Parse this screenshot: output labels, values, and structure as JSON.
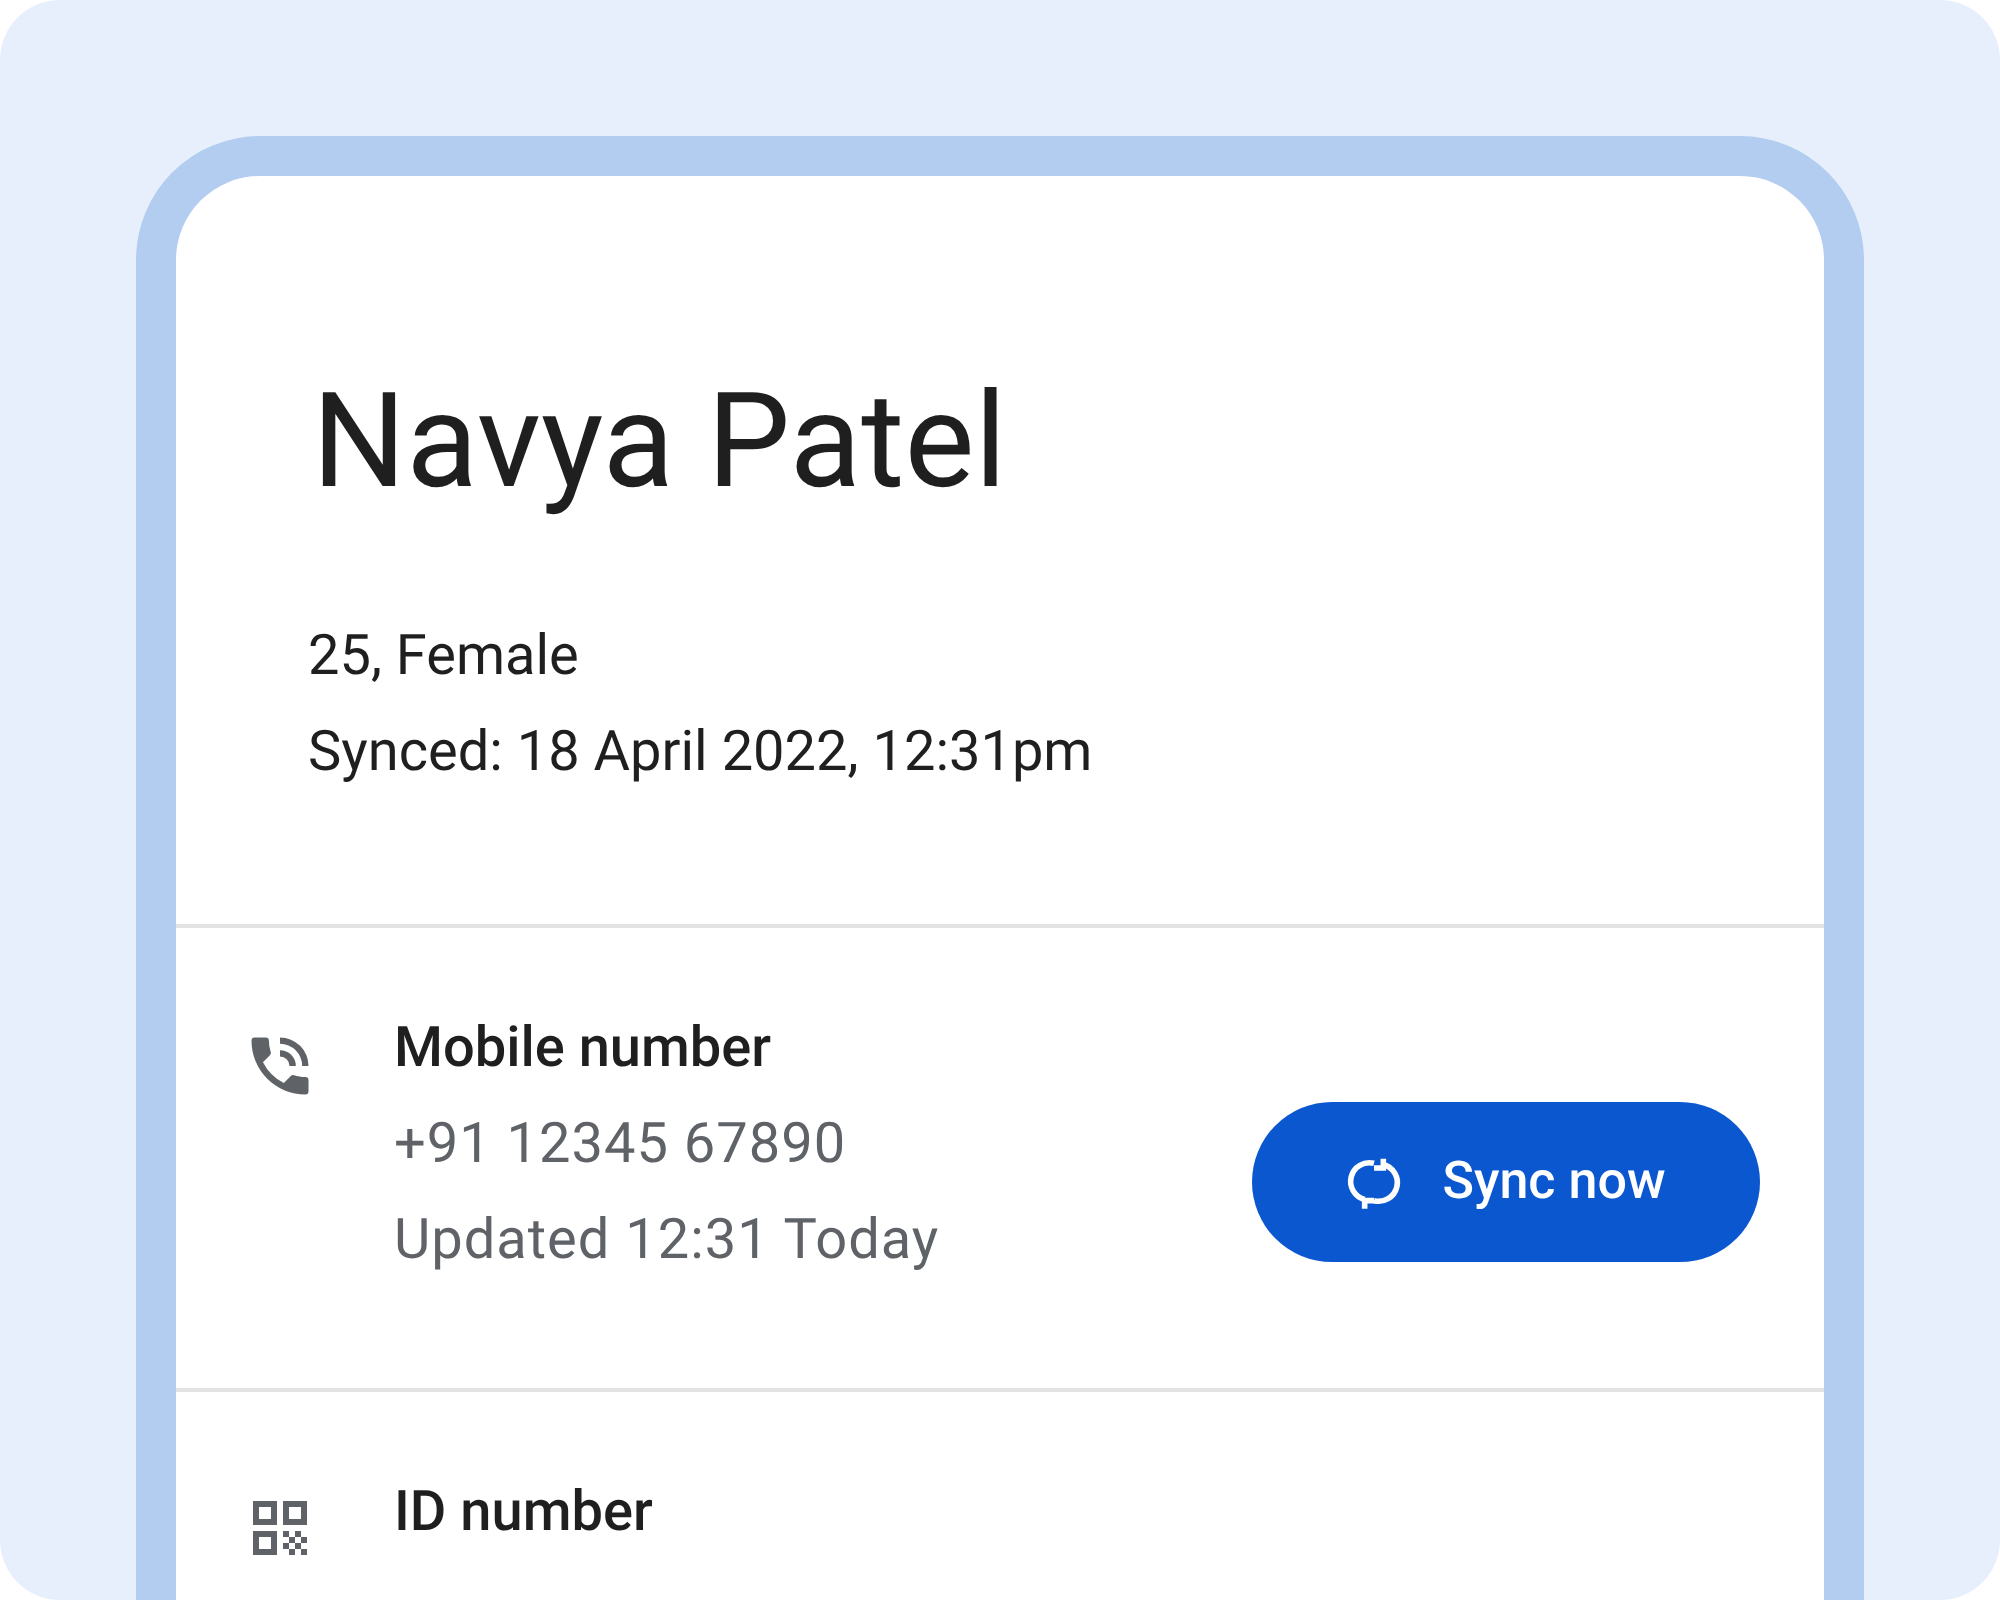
{
  "profile": {
    "name": "Navya Patel",
    "age_gender": "25, Female",
    "synced": "Synced: 18 April 2022, 12:31pm"
  },
  "rows": [
    {
      "kind": "phone",
      "title": "Mobile number",
      "lines": [
        "+91 12345 67890",
        "Updated 12:31 Today"
      ],
      "button": "Sync now"
    },
    {
      "kind": "id",
      "title": "ID number",
      "lines": []
    }
  ]
}
